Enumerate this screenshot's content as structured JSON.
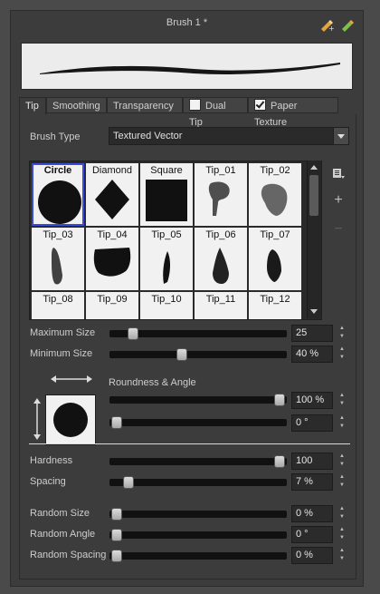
{
  "window": {
    "title": "Brush 1 *"
  },
  "icons": {
    "add_preset": "add-brush-preset-icon",
    "import": "import-brush-icon",
    "menu": "menu-icon",
    "add": "plus-icon",
    "remove": "minus-icon"
  },
  "tabs": [
    {
      "label": "Tip",
      "active": true
    },
    {
      "label": "Smoothing"
    },
    {
      "label": "Transparency"
    },
    {
      "label": "Dual Tip",
      "checked": false
    },
    {
      "label": "Paper Texture",
      "checked": true
    }
  ],
  "brush_type": {
    "label": "Brush Type",
    "value": "Textured Vector"
  },
  "tips": [
    "Circle",
    "Diamond",
    "Square",
    "Tip_01",
    "Tip_02",
    "Tip_03",
    "Tip_04",
    "Tip_05",
    "Tip_06",
    "Tip_07",
    "Tip_08",
    "Tip_09",
    "Tip_10",
    "Tip_11",
    "Tip_12"
  ],
  "selected_tip": "Circle",
  "sizes": {
    "max": {
      "label": "Maximum Size",
      "value": "25",
      "fraction": 0.1
    },
    "min": {
      "label": "Minimum Size",
      "value": "40 %",
      "fraction": 0.4
    }
  },
  "roundness_angle": {
    "label": "Roundness & Angle",
    "roundness": {
      "value": "100 %",
      "fraction": 1.0
    },
    "angle": {
      "value": "0 °",
      "fraction": 0.0
    }
  },
  "hardness": {
    "label": "Hardness",
    "value": "100",
    "fraction": 1.0
  },
  "spacing": {
    "label": "Spacing",
    "value": "7 %",
    "fraction": 0.07
  },
  "random": {
    "size": {
      "label": "Random Size",
      "value": "0 %",
      "fraction": 0.0
    },
    "angle": {
      "label": "Random Angle",
      "value": "0 °",
      "fraction": 0.0
    },
    "spacing": {
      "label": "Random Spacing",
      "value": "0 %",
      "fraction": 0.0
    }
  },
  "colors": {
    "selection": "#3a4cd6",
    "panel": "#3c3c3c"
  }
}
